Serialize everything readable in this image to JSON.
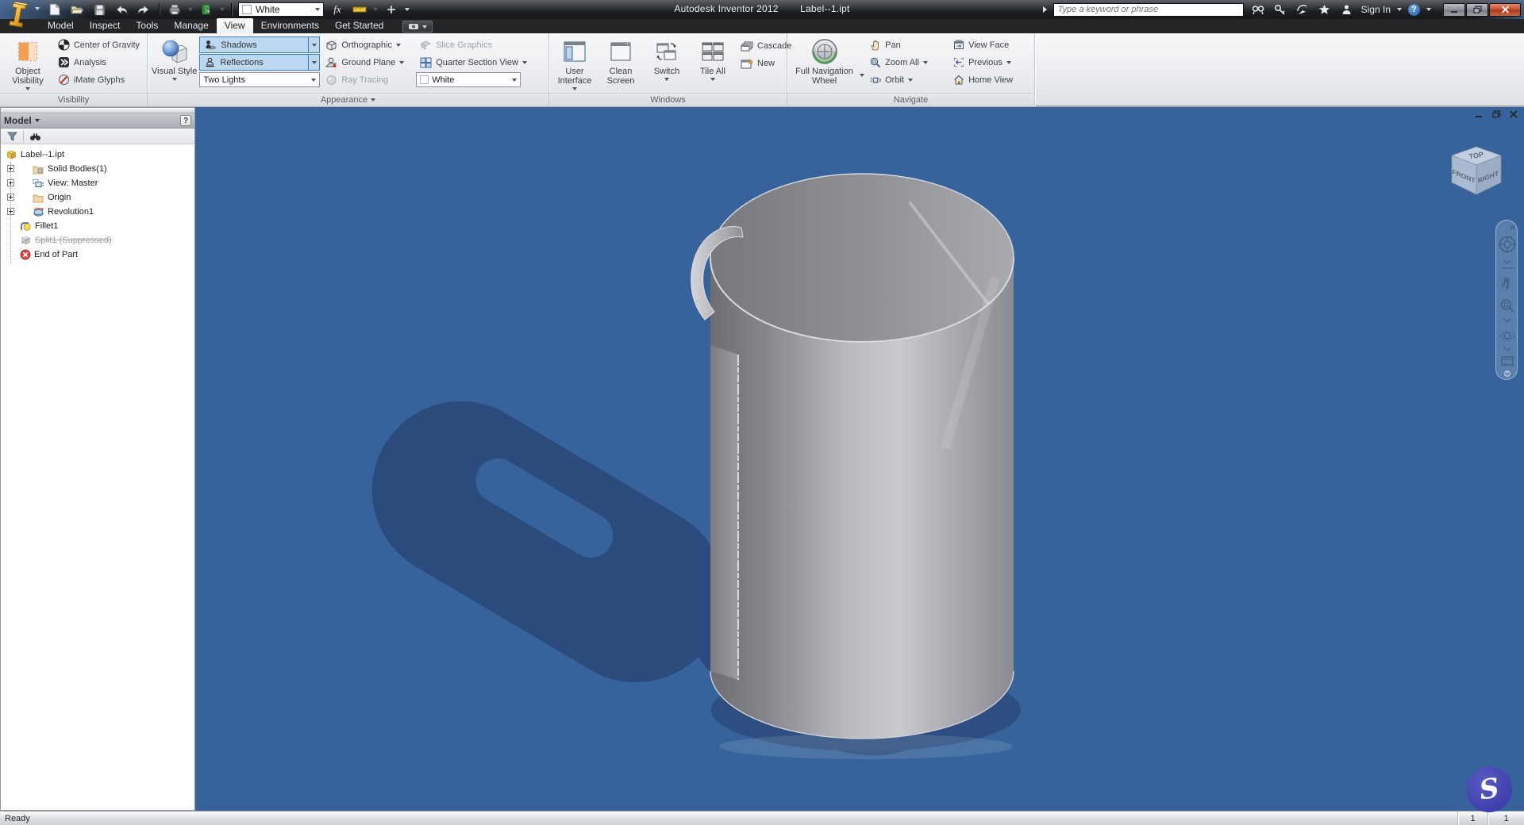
{
  "colors": {
    "viewport_bg": "#36639b",
    "ground_shadow": "#2a4b7c",
    "selection_fill": "#bdd8f1",
    "selection_border": "#3d7ebd",
    "recorder_badge": "#4545b2"
  },
  "titlebar": {
    "app_title": "Autodesk Inventor 2012",
    "doc_title": "Label--1.ipt",
    "search_placeholder": "Type a keyword or phrase",
    "sign_in_label": "Sign In",
    "help_glyph": "?",
    "qat": {
      "color_value": "White",
      "fx_label": "fx"
    }
  },
  "ribbon": {
    "tabs": [
      {
        "label": "Model"
      },
      {
        "label": "Inspect"
      },
      {
        "label": "Tools"
      },
      {
        "label": "Manage"
      },
      {
        "label": "View"
      },
      {
        "label": "Environments"
      },
      {
        "label": "Get Started"
      }
    ],
    "visibility": {
      "panel_label": "Visibility",
      "object_visibility": "Object Visibility",
      "center_of_gravity": "Center of Gravity",
      "analysis": "Analysis",
      "imate_glyphs": "iMate Glyphs"
    },
    "appearance": {
      "panel_label": "Appearance",
      "visual_style": "Visual Style",
      "shadows": "Shadows",
      "reflections": "Reflections",
      "lights_value": "Two Lights",
      "orthographic": "Orthographic",
      "ground_plane": "Ground Plane",
      "ray_tracing": "Ray Tracing",
      "slice_graphics": "Slice Graphics",
      "quarter_section_view": "Quarter Section View",
      "color_value": "White"
    },
    "windows": {
      "panel_label": "Windows",
      "user_interface": "User Interface",
      "clean_screen": "Clean Screen",
      "switch_label": "Switch",
      "tile_all": "Tile All",
      "cascade": "Cascade",
      "new_label": "New"
    },
    "navigate": {
      "panel_label": "Navigate",
      "full_navigation_wheel": "Full Navigation Wheel",
      "pan": "Pan",
      "zoom_all": "Zoom All",
      "orbit": "Orbit",
      "view_face": "View Face",
      "previous": "Previous",
      "home_view": "Home View"
    }
  },
  "browser": {
    "header": "Model",
    "help_glyph": "?",
    "items": [
      {
        "label": "Label--1.ipt"
      },
      {
        "label": "Solid Bodies(1)"
      },
      {
        "label": "View: Master"
      },
      {
        "label": "Origin"
      },
      {
        "label": "Revolution1"
      },
      {
        "label": "Fillet1"
      },
      {
        "label": "Split1 (Suppressed)"
      },
      {
        "label": "End of Part"
      }
    ]
  },
  "viewport": {
    "viewcube": {
      "top": "TOP",
      "front": "FRONT",
      "right": "RIGHT"
    }
  },
  "statusbar": {
    "status": "Ready",
    "counter_left": "1",
    "counter_right": "1"
  }
}
